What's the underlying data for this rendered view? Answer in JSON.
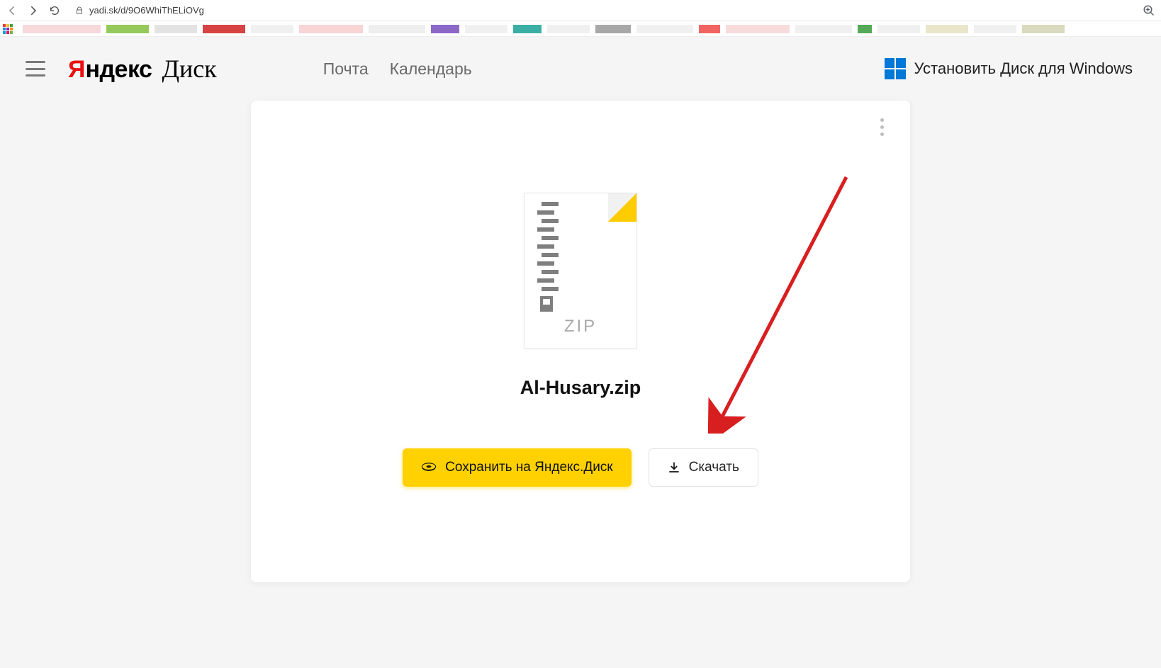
{
  "browser": {
    "url": "yadi.sk/d/9O6WhiThELiOVg"
  },
  "header": {
    "logo_brand": "Яндекс",
    "logo_product": "Диск",
    "nav": {
      "mail": "Почта",
      "calendar": "Календарь"
    },
    "install": "Установить Диск для Windows"
  },
  "card": {
    "file_type": "ZIP",
    "file_name": "Al-Husary.zip",
    "save_button": "Сохранить на Яндекс.Диск",
    "download_button": "Скачать"
  },
  "colors": {
    "accent_yellow": "#ffd100",
    "brand_red": "#e81011",
    "windows_blue": "#0078d7"
  }
}
